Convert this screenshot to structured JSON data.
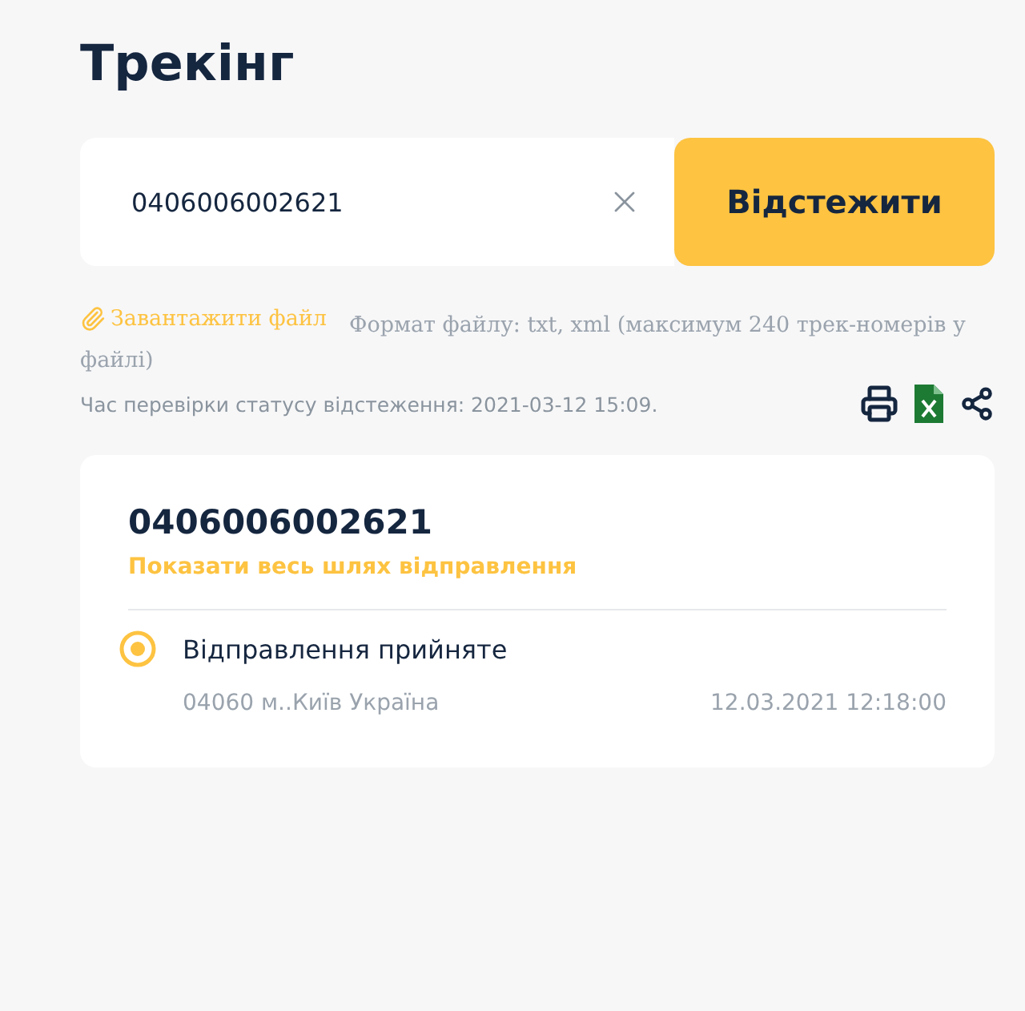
{
  "title": "Трекінг",
  "search": {
    "value": "0406006002621",
    "button": "Відстежити"
  },
  "upload": {
    "link": "Завантажити файл",
    "format": "Формат файлу: txt, xml (максимум 240 трек-номерів у файлі)"
  },
  "check_time": "Час перевірки статусу відстеження: 2021-03-12 15:09.",
  "result": {
    "number": "0406006002621",
    "show_path": "Показати весь шлях відправлення",
    "events": [
      {
        "status": "Відправлення прийняте",
        "place": "04060 м..Київ Україна",
        "time": "12.03.2021 12:18:00"
      }
    ]
  }
}
